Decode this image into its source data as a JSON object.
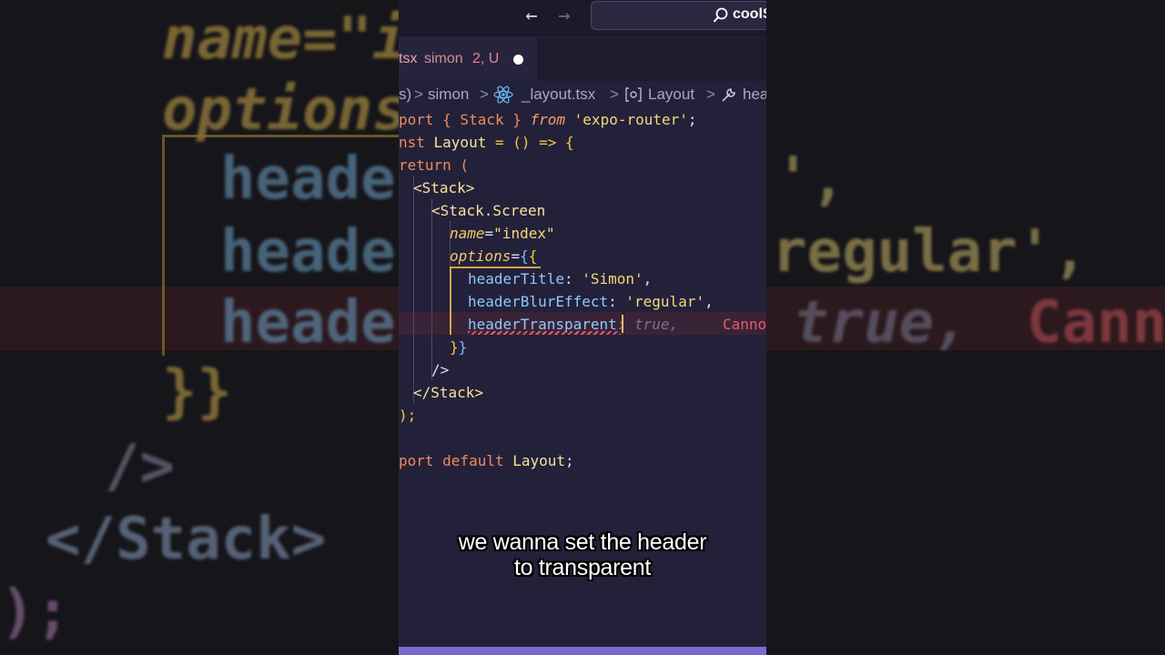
{
  "titlebar": {
    "back_icon": "arrow-left-icon",
    "forward_icon": "arrow-right-icon",
    "search_icon": "search-icon",
    "search_text": "coolS"
  },
  "tab": {
    "file_fragment": "tsx",
    "folder": "simon",
    "status": "2, U",
    "modified_indicator": "dot"
  },
  "breadcrumb": {
    "parts": [
      "s)",
      "simon",
      "_layout.tsx",
      "Layout",
      "hea"
    ],
    "sep": ">"
  },
  "code": {
    "l1_a": "port { Stack } ",
    "l1_b": "from",
    "l1_c": " 'expo-router'",
    "l1_d": ";",
    "l2_a": "nst ",
    "l2_b": "Layout",
    "l2_c": " = () => {",
    "l3_a": "return",
    "l3_b": " (",
    "l4": "<Stack>",
    "l5": "<Stack.Screen",
    "l6_a": "name",
    "l6_b": "=",
    "l6_c": "\"index\"",
    "l7_a": "options",
    "l7_b": "=",
    "l7_c": "{",
    "l7_d": "{",
    "l8_a": "headerTitle",
    "l8_b": ": ",
    "l8_c": "'Simon'",
    "l8_d": ",",
    "l9_a": "headerBlurEffect",
    "l9_b": ": ",
    "l9_c": "'regular'",
    "l9_d": ",",
    "l10_a": "headerTransparent",
    "l10_ghost": ": true,",
    "l10_err": "Canno",
    "l11_a": "}",
    "l11_b": "}",
    "l12": "/>",
    "l13": "</Stack>",
    "l14": ");",
    "l16_a": "port default ",
    "l16_b": "Layout",
    "l16_c": ";"
  },
  "background": {
    "left_line1": "name=\"in",
    "left_line2": "options=",
    "left_line3": "headerT",
    "left_line4": "headerB",
    "left_line5": "headerT",
    "left_line6": "}}",
    "left_line7": "/>",
    "left_line8": "</Stack>",
    "left_line9": ");",
    "right_line1": "',",
    "right_line2": "regular',",
    "right_line3": "true,",
    "right_line4": "Canno"
  },
  "subtitle": {
    "line1": "we wanna set the header",
    "line2": "to transparent"
  },
  "colors": {
    "editor_bg": "#23213a",
    "keyword": "#f08a5d",
    "string": "#f5d978",
    "error": "#e85a6a",
    "status_bar": "#7a6ad0"
  }
}
